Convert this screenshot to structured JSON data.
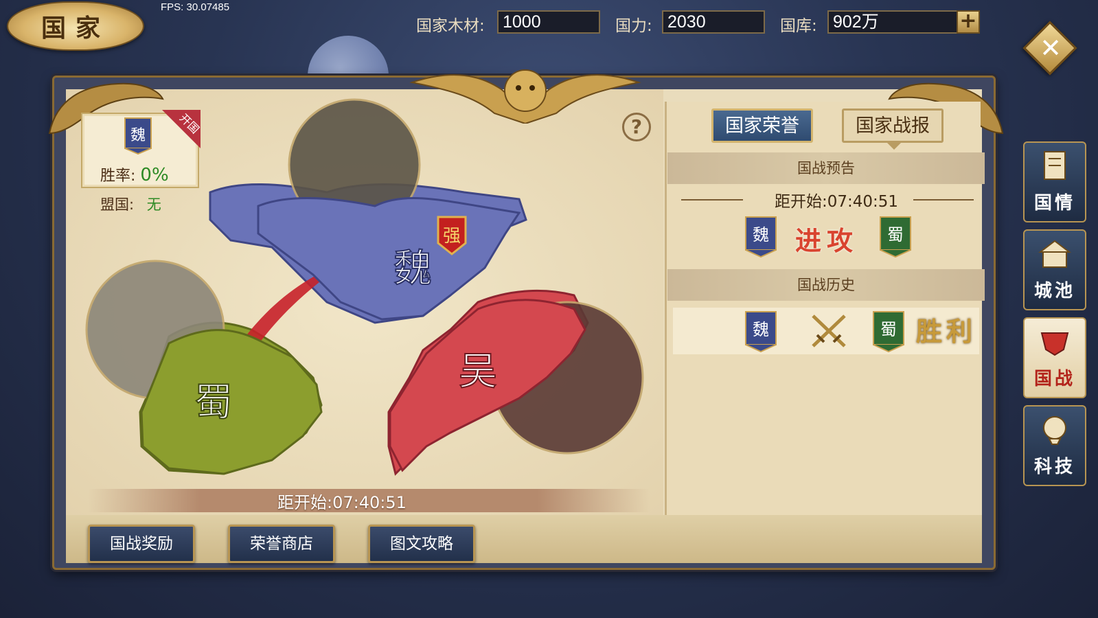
{
  "header": {
    "title": "国家",
    "fps": "FPS: 30.07485",
    "resources": [
      {
        "label": "国家木材:",
        "value": "1000"
      },
      {
        "label": "国力:",
        "value": "2030"
      },
      {
        "label": "国库:",
        "value": "902万"
      }
    ],
    "add_label": "+",
    "close_label": "✕"
  },
  "kingdom": {
    "name": "魏",
    "badge": "开国",
    "winrate_label": "胜率:",
    "winrate_value": "0%",
    "ally_label": "盟国:",
    "ally_value": "无",
    "help": "?"
  },
  "map": {
    "regions": [
      {
        "name": "魏",
        "color": "#6a73b8",
        "tag": "强"
      },
      {
        "name": "蜀",
        "color": "#8a9b2c"
      },
      {
        "name": "吴",
        "color": "#d2464f"
      }
    ],
    "countdown": "距开始:07:40:51"
  },
  "buttons": [
    "国战奖励",
    "荣誉商店",
    "图文攻略"
  ],
  "panel": {
    "tabs": [
      {
        "label": "国家荣誉",
        "active": true
      },
      {
        "label": "国家战报",
        "active": false
      }
    ],
    "preview": {
      "heading": "国战预告",
      "countdown": "距开始:07:40:51",
      "attacker": "魏",
      "action": "进攻",
      "defender": "蜀"
    },
    "history": {
      "heading": "国战历史",
      "attacker": "魏",
      "defender": "蜀",
      "result": "胜利"
    }
  },
  "side_menu": [
    {
      "label": "国情",
      "icon": "scroll-icon",
      "active": false
    },
    {
      "label": "城池",
      "icon": "city-icon",
      "active": false
    },
    {
      "label": "国战",
      "icon": "war-icon",
      "active": true
    },
    {
      "label": "科技",
      "icon": "tech-icon",
      "active": false
    }
  ],
  "colors": {
    "wei_blue": "#3b4a8a",
    "shu_green": "#2f6b33",
    "wu_red": "#d2464f",
    "gold": "#b89552"
  }
}
